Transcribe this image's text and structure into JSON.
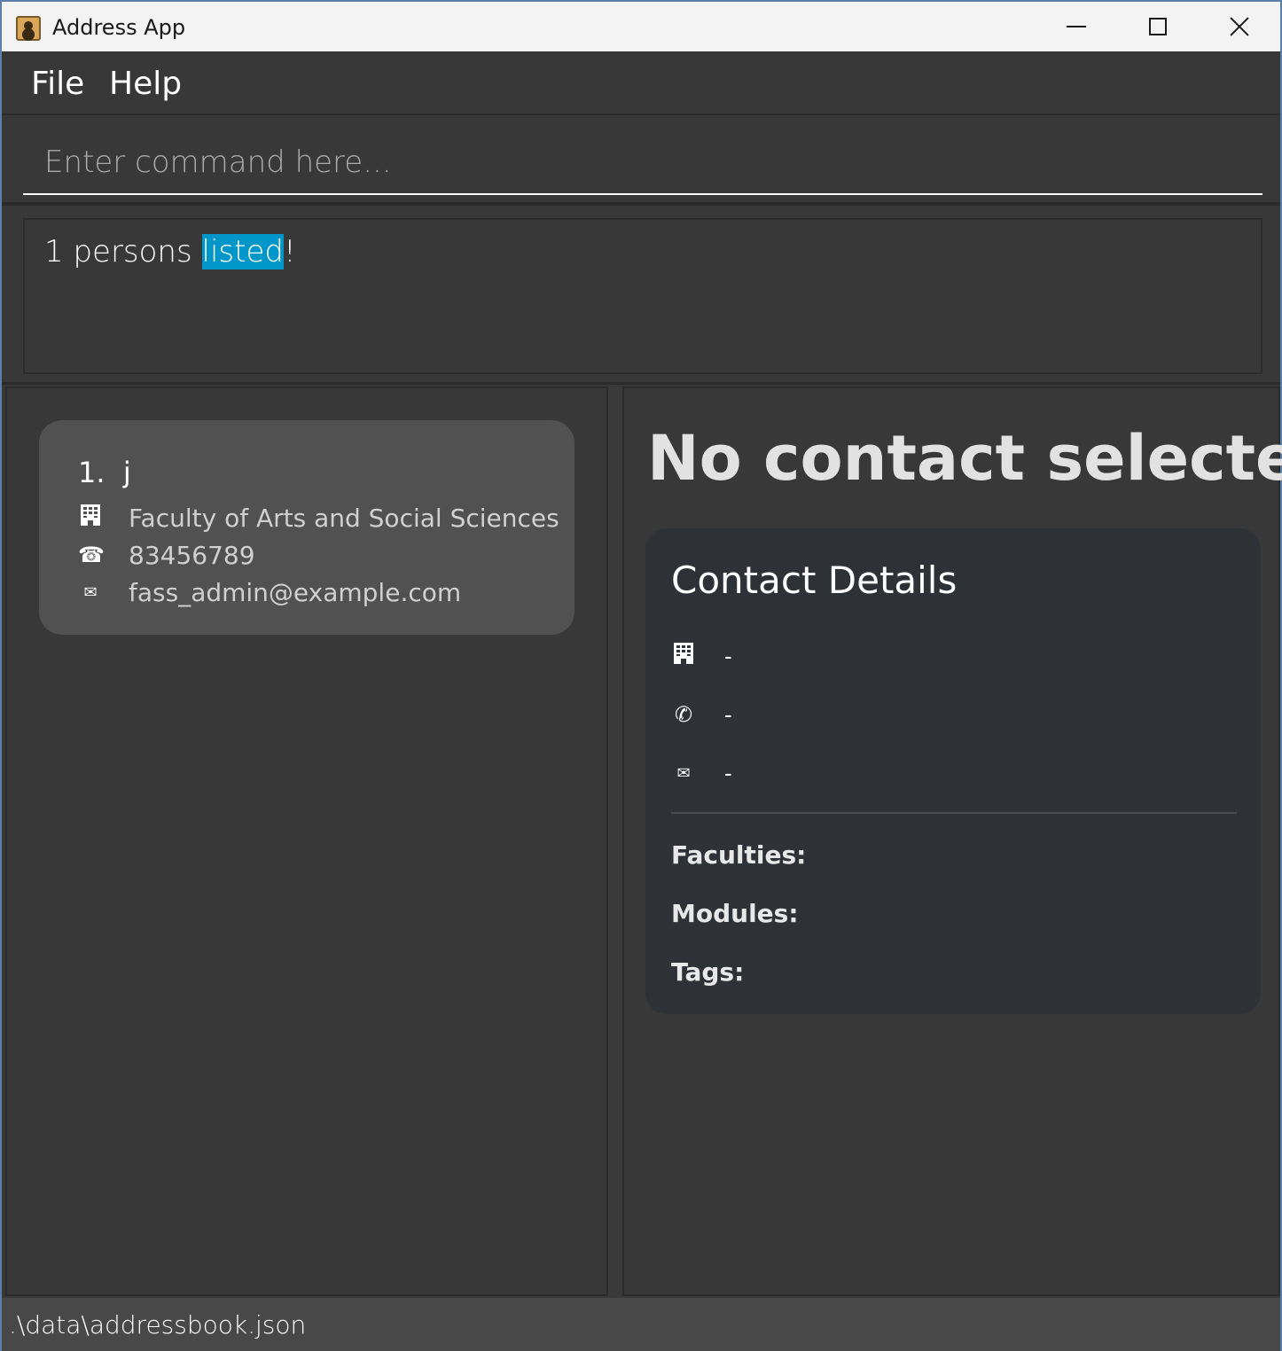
{
  "window": {
    "title": "Address App"
  },
  "menu": {
    "file": "File",
    "help": "Help"
  },
  "command": {
    "placeholder": "Enter command here..."
  },
  "result": {
    "before": "1 persons ",
    "highlighted": "listed",
    "after": "!"
  },
  "person_list": [
    {
      "index": "1.",
      "name": "j",
      "faculty": "Faculty of Arts and Social Sciences",
      "phone": "83456789",
      "email": "fass_admin@example.com"
    }
  ],
  "detail": {
    "heading": "No contact selected",
    "card_title": "Contact Details",
    "faculty_value": "-",
    "phone_value": "-",
    "email_value": "-",
    "faculties_label": "Faculties:",
    "modules_label": "Modules:",
    "tags_label": "Tags:"
  },
  "status": {
    "file_path": ".\\data\\addressbook.json"
  },
  "icons": {
    "faculty": "building-icon",
    "phone": "phone-icon",
    "email": "envelope-icon"
  },
  "colors": {
    "highlight": "#0096c9",
    "card": "#515151",
    "details_card": "#2e3136",
    "background": "#383838"
  }
}
